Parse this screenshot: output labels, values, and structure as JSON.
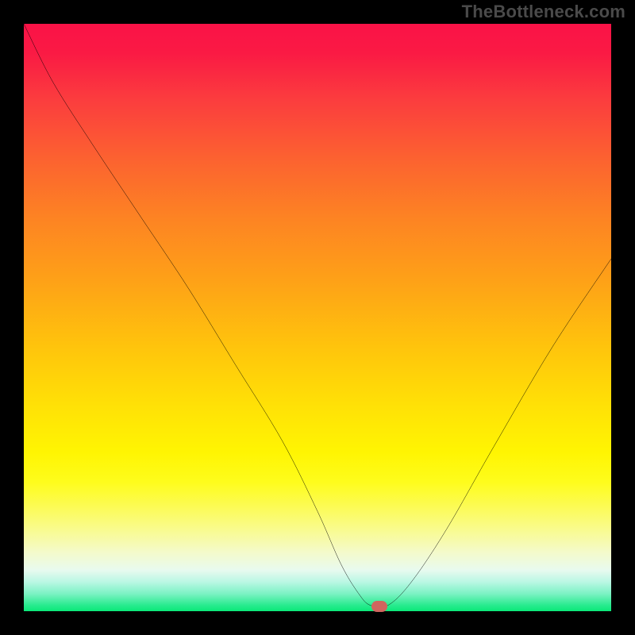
{
  "watermark": "TheBottleneck.com",
  "chart_data": {
    "type": "line",
    "title": "",
    "xlabel": "",
    "ylabel": "",
    "xlim": [
      0,
      100
    ],
    "ylim": [
      0,
      100
    ],
    "grid": false,
    "legend": false,
    "background_gradient": {
      "direction": "vertical",
      "stops": [
        {
          "pos": 0,
          "color": "#fa1247"
        },
        {
          "pos": 55,
          "color": "#ffe106"
        },
        {
          "pos": 100,
          "color": "#0ae878"
        }
      ]
    },
    "series": [
      {
        "name": "bottleneck-curve",
        "color": "#000000",
        "x": [
          0,
          5,
          12,
          20,
          28,
          36,
          44,
          50,
          54,
          57,
          59,
          62,
          66,
          72,
          80,
          90,
          100
        ],
        "values": [
          100,
          90,
          79,
          67,
          55,
          42,
          29,
          17,
          8,
          3,
          1,
          1,
          5,
          14,
          28,
          45,
          60
        ]
      }
    ],
    "marker": {
      "name": "optimal-point",
      "x": 60.5,
      "y": 0.8,
      "color": "#d0655e"
    }
  }
}
